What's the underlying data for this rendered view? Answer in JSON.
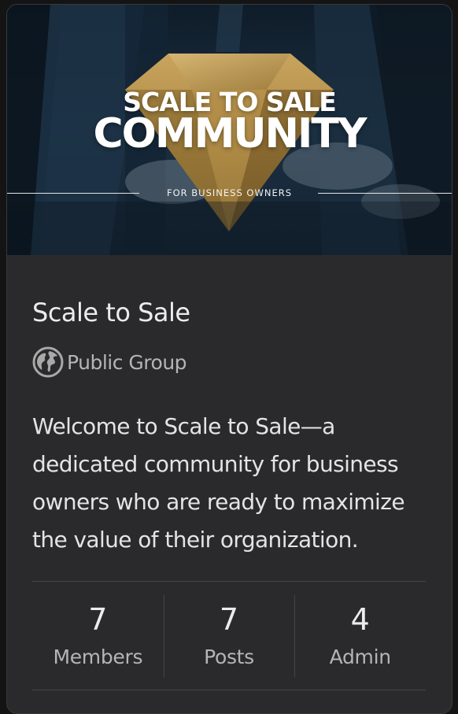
{
  "cover": {
    "title_line1": "SCALE TO SALE",
    "title_line2": "COMMUNITY",
    "tagline": "FOR BUSINESS OWNERS",
    "accent_color": "#b8934a"
  },
  "group": {
    "name": "Scale to Sale",
    "privacy_icon": "globe-icon",
    "privacy_label": "Public Group",
    "description": "Welcome to Scale to Sale—a dedicated community for business owners who are ready to maximize the value of their organization."
  },
  "stats": [
    {
      "value": "7",
      "label": "Members"
    },
    {
      "value": "7",
      "label": "Posts"
    },
    {
      "value": "4",
      "label": "Admin"
    }
  ]
}
